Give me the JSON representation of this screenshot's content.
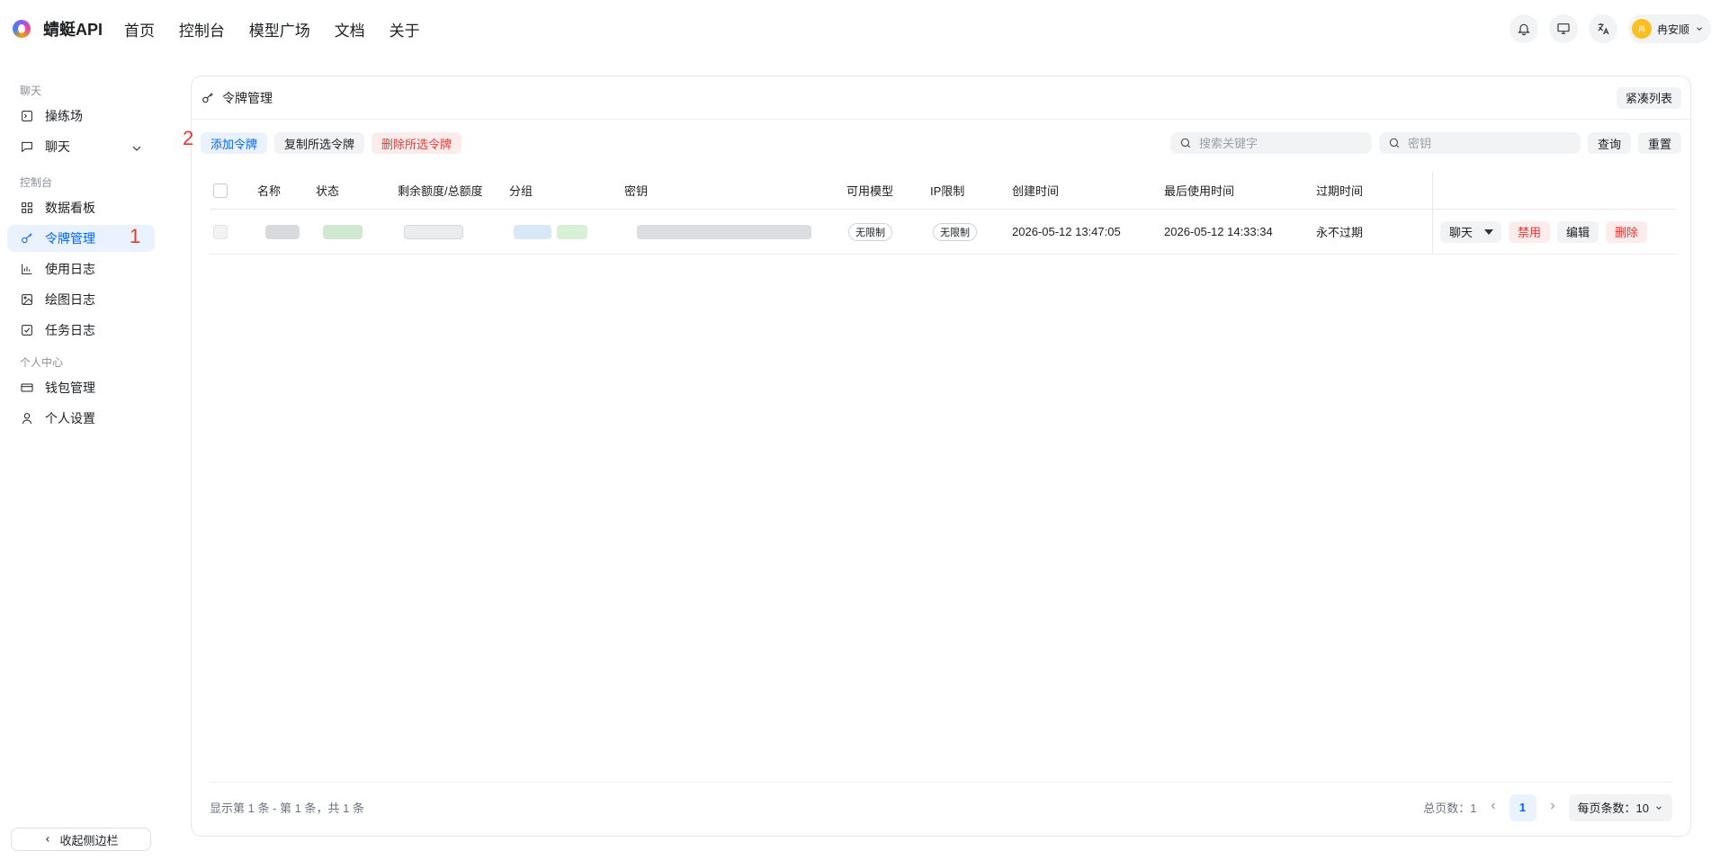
{
  "header": {
    "brand": "蜻蜓API",
    "nav": [
      "首页",
      "控制台",
      "模型广场",
      "文档",
      "关于"
    ],
    "user_name": "冉安顺",
    "avatar_text": "冉"
  },
  "sidebar": {
    "sections": [
      {
        "title": "聊天",
        "items": [
          {
            "label": "操练场",
            "icon": "terminal-icon"
          },
          {
            "label": "聊天",
            "icon": "chat-icon",
            "expandable": true
          }
        ]
      },
      {
        "title": "控制台",
        "items": [
          {
            "label": "数据看板",
            "icon": "dashboard-icon"
          },
          {
            "label": "令牌管理",
            "icon": "key-icon",
            "active": true
          },
          {
            "label": "使用日志",
            "icon": "chart-icon"
          },
          {
            "label": "绘图日志",
            "icon": "image-icon"
          },
          {
            "label": "任务日志",
            "icon": "checkbox-icon"
          }
        ]
      },
      {
        "title": "个人中心",
        "items": [
          {
            "label": "钱包管理",
            "icon": "wallet-icon"
          },
          {
            "label": "个人设置",
            "icon": "user-icon"
          }
        ]
      }
    ],
    "collapse_label": "收起侧边栏",
    "annotation_1": "1"
  },
  "card": {
    "title": "令牌管理",
    "compact_label": "紧凑列表",
    "annotation_2": "2"
  },
  "toolbar": {
    "add_label": "添加令牌",
    "copy_label": "复制所选令牌",
    "delete_label": "删除所选令牌",
    "search_placeholder": "搜索关键字",
    "key_placeholder": "密钥",
    "query_label": "查询",
    "reset_label": "重置"
  },
  "table": {
    "columns": [
      "名称",
      "状态",
      "剩余额度/总额度",
      "分组",
      "密钥",
      "可用模型",
      "IP限制",
      "创建时间",
      "最后使用时间",
      "过期时间"
    ],
    "rows": [
      {
        "models": "无限制",
        "ip": "无限制",
        "created": "2026-05-12 13:47:05",
        "last_used": "2026-05-12 14:33:34",
        "expires": "永不过期",
        "actions": {
          "chat": "聊天",
          "disable": "禁用",
          "edit": "编辑",
          "delete": "删除"
        }
      }
    ]
  },
  "footer": {
    "summary": "显示第 1 条 - 第 1 条，共 1 条",
    "total_pages_label": "总页数：1",
    "current_page": "1",
    "per_page_label": "每页条数：10"
  },
  "colors": {
    "accent": "#0064fa",
    "danger": "#e53935"
  }
}
